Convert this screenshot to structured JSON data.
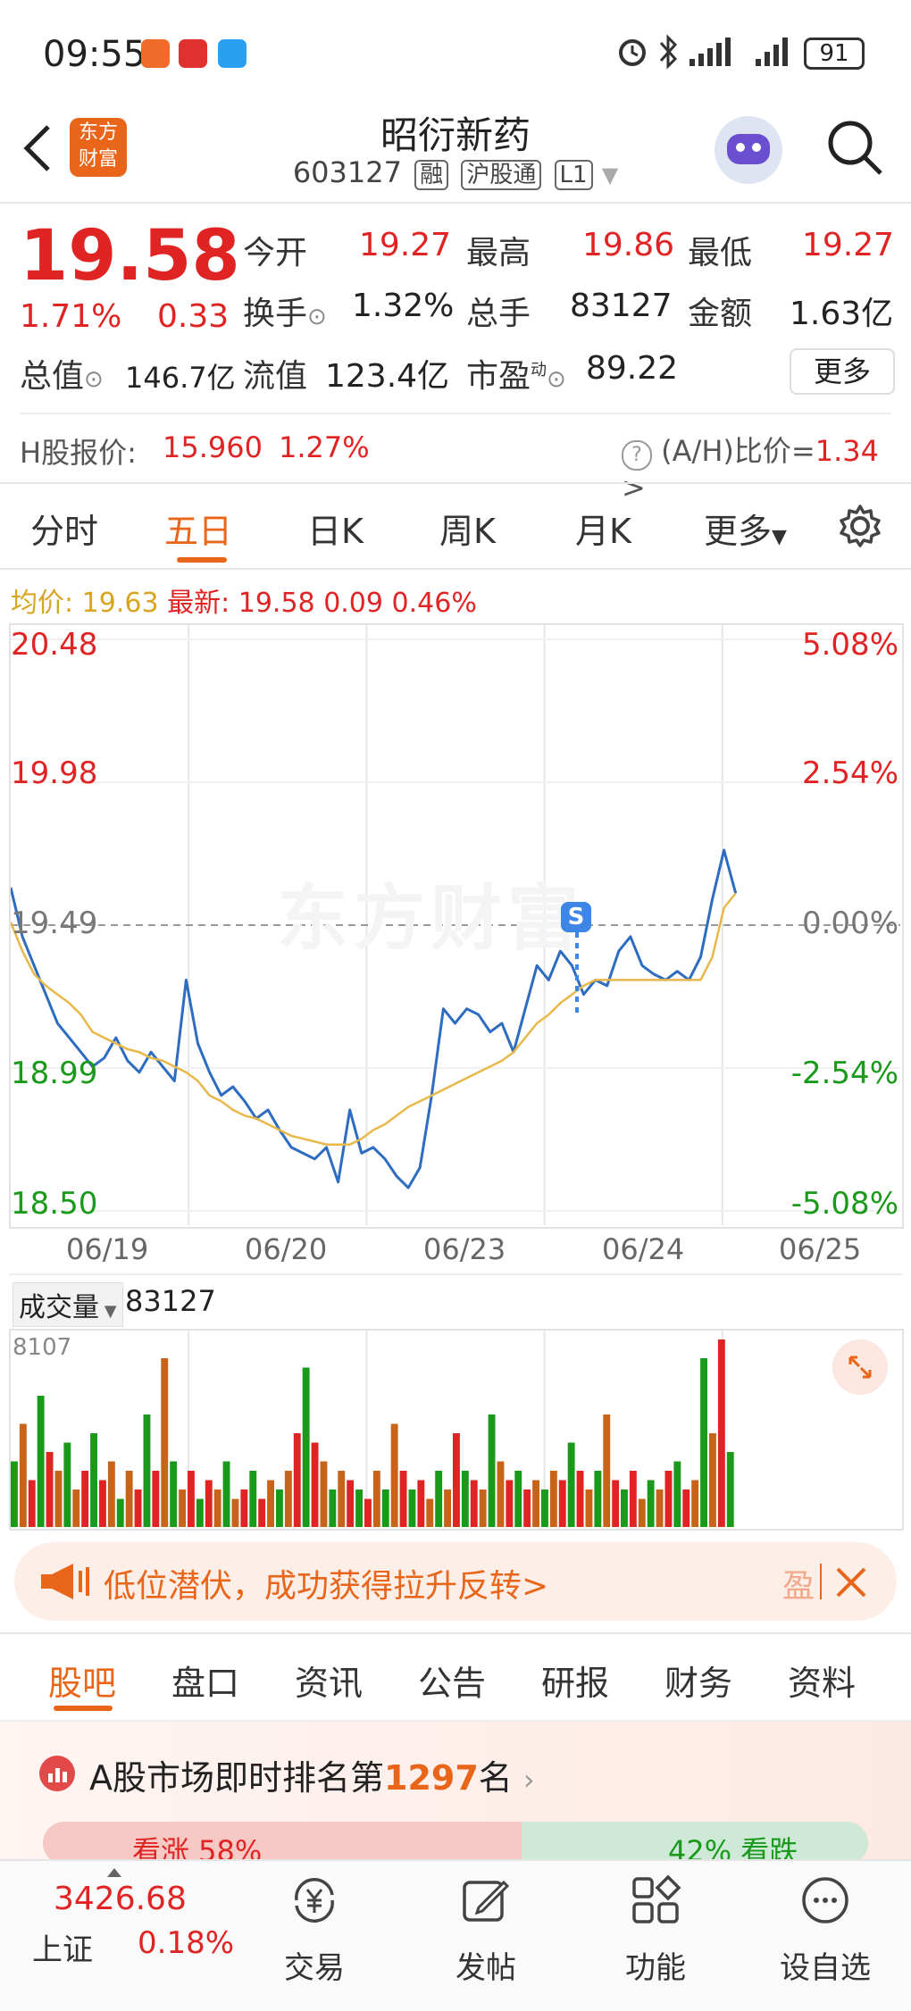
{
  "status": {
    "time": "09:55",
    "battery": "91"
  },
  "header": {
    "back_icon": "chevron-left-icon",
    "logo_text_1": "东方",
    "logo_text_2": "财富",
    "stock_name": "昭衍新药",
    "stock_code": "603127",
    "tags": [
      "融",
      "沪股通",
      "L1"
    ]
  },
  "quote": {
    "price": "19.58",
    "change_pct": "1.71%",
    "change": "0.33",
    "open_label": "今开",
    "open": "19.27",
    "high_label": "最高",
    "high": "19.86",
    "low_label": "最低",
    "low": "19.27",
    "turnover_label": "换手",
    "turnover": "1.32%",
    "volume_label": "总手",
    "volume": "83127",
    "amount_label": "金额",
    "amount": "1.63亿",
    "mktcap_label": "总值",
    "mktcap": "146.7亿",
    "float_label": "流值",
    "float": "123.4亿",
    "pe_label": "市盈",
    "pe_sup": "动",
    "pe": "89.22",
    "more_label": "更多"
  },
  "hshare": {
    "label": "H股报价:",
    "price": "15.960",
    "pct": "1.27%",
    "ratio_label": "(A/H)比价=",
    "ratio": "1.34",
    "arrow": ">"
  },
  "chart_tabs": [
    "分时",
    "五日",
    "日K",
    "周K",
    "月K",
    "更多"
  ],
  "active_tab": "五日",
  "info_line": {
    "avg_label": "均价:",
    "avg": "19.63",
    "latest_label": "最新:",
    "latest": "19.58",
    "chg": "0.09",
    "pct": "0.46%"
  },
  "chart_data": {
    "type": "line",
    "x_labels": [
      "06/19",
      "06/20",
      "06/23",
      "06/24",
      "06/25"
    ],
    "y_left": [
      "20.48",
      "19.98",
      "19.49",
      "18.99",
      "18.50"
    ],
    "y_right": [
      "5.08%",
      "2.54%",
      "0.00%",
      "-2.54%",
      "-5.08%"
    ],
    "ylim": [
      18.5,
      20.48
    ],
    "ref_price": 19.49,
    "watermark": "东方财富",
    "series": [
      {
        "name": "最新",
        "color": "#2d6cc0",
        "values": [
          19.62,
          19.45,
          19.35,
          19.25,
          19.15,
          19.1,
          19.05,
          19.0,
          19.03,
          19.1,
          19.02,
          18.98,
          19.05,
          19.0,
          18.95,
          19.3,
          19.08,
          18.98,
          18.9,
          18.93,
          18.88,
          18.82,
          18.85,
          18.78,
          18.72,
          18.7,
          18.68,
          18.72,
          18.6,
          18.85,
          18.7,
          18.72,
          18.68,
          18.62,
          18.58,
          18.65,
          18.9,
          19.2,
          19.15,
          19.2,
          19.18,
          19.12,
          19.15,
          19.05,
          19.2,
          19.35,
          19.3,
          19.4,
          19.35,
          19.25,
          19.3,
          19.28,
          19.4,
          19.45,
          19.35,
          19.32,
          19.3,
          19.33,
          19.3,
          19.38,
          19.58,
          19.75,
          19.6
        ]
      },
      {
        "name": "均价",
        "color": "#e8b84a",
        "values": [
          19.5,
          19.4,
          19.32,
          19.28,
          19.25,
          19.22,
          19.18,
          19.12,
          19.1,
          19.08,
          19.06,
          19.05,
          19.03,
          19.02,
          19.0,
          18.98,
          18.95,
          18.9,
          18.88,
          18.85,
          18.83,
          18.82,
          18.8,
          18.78,
          18.76,
          18.75,
          18.74,
          18.73,
          18.73,
          18.73,
          18.75,
          18.78,
          18.8,
          18.83,
          18.86,
          18.88,
          18.9,
          18.92,
          18.94,
          18.96,
          18.98,
          19.0,
          19.02,
          19.05,
          19.1,
          19.15,
          19.18,
          19.22,
          19.25,
          19.28,
          19.3,
          19.3,
          19.3,
          19.3,
          19.3,
          19.3,
          19.3,
          19.3,
          19.3,
          19.3,
          19.38,
          19.55,
          19.6
        ]
      }
    ]
  },
  "volume": {
    "label": "成交量",
    "value": "83127",
    "max": "8107",
    "bars": [
      0.35,
      0.55,
      0.25,
      0.7,
      0.4,
      0.3,
      0.45,
      0.2,
      0.3,
      0.5,
      0.25,
      0.35,
      0.15,
      0.3,
      0.2,
      0.6,
      0.3,
      0.9,
      0.35,
      0.2,
      0.3,
      0.15,
      0.25,
      0.2,
      0.35,
      0.15,
      0.2,
      0.3,
      0.15,
      0.25,
      0.2,
      0.3,
      0.5,
      0.85,
      0.45,
      0.35,
      0.2,
      0.3,
      0.25,
      0.2,
      0.15,
      0.3,
      0.2,
      0.55,
      0.3,
      0.2,
      0.25,
      0.15,
      0.3,
      0.2,
      0.5,
      0.3,
      0.25,
      0.2,
      0.6,
      0.35,
      0.25,
      0.3,
      0.2,
      0.25,
      0.2,
      0.3,
      0.25,
      0.45,
      0.3,
      0.2,
      0.3,
      0.6,
      0.25,
      0.2,
      0.3,
      0.15,
      0.25,
      0.2,
      0.3,
      0.35,
      0.2,
      0.25,
      0.9,
      0.5,
      1.0,
      0.4
    ]
  },
  "banner": {
    "text": "低位潜伏，成功获得拉升反转>",
    "right_char": "盈"
  },
  "bar_tabs": [
    "股吧",
    "盘口",
    "资讯",
    "公告",
    "研报",
    "财务",
    "资料"
  ],
  "active_bar_tab": "股吧",
  "rank": {
    "prefix": "A股市场即时排名第",
    "rank": "1297",
    "suffix": "名"
  },
  "sentiment": {
    "left": "看涨 58%",
    "right": "42% 看跌"
  },
  "bottom_nav": {
    "index_value": "3426.68",
    "index_name": "上证",
    "index_pct": "0.18%",
    "items": [
      "交易",
      "发帖",
      "功能",
      "设自选"
    ]
  },
  "colors": {
    "up": "#e02424",
    "down": "#1a9a1a",
    "accent": "#e8651a",
    "line": "#2d6cc0",
    "avg": "#e8b84a"
  }
}
